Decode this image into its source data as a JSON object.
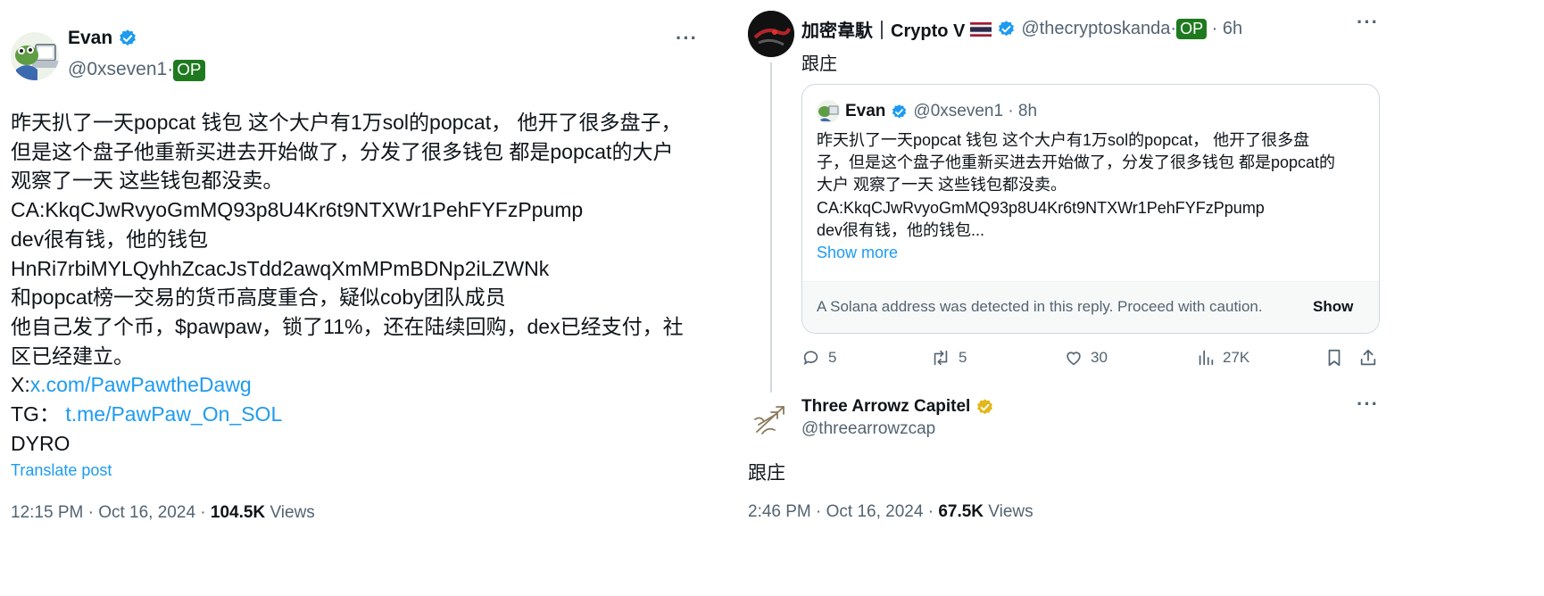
{
  "left_tweet": {
    "name": "Evan",
    "handle": "@0xseven1·",
    "op_label": "OP",
    "lines": [
      "昨天扒了一天popcat 钱包 这个大户有1万sol的popcat， 他开了很多盘子，",
      "但是这个盘子他重新买进去开始做了，分发了很多钱包 都是popcat的大户",
      "观察了一天 这些钱包都没卖。",
      "CA:KkqCJwRvyoGmMQ93p8U4Kr6t9NTXWr1PehFYFzPpump",
      "dev很有钱，他的钱包",
      "HnRi7rbiMYLQyhhZcacJsTdd2awqXmMPmBDNp2iLZWNk",
      "和popcat榜一交易的货币高度重合，疑似coby团队成员",
      "他自己发了个币，$pawpaw，锁了11%，还在陆续回购，dex已经支付，社",
      "区已经建立。"
    ],
    "x_prefix": "X:",
    "x_link": "x.com/PawPawtheDawg",
    "tg_prefix": "TG：",
    "tg_link": "t.me/PawPaw_On_SOL",
    "last_line": "DYRO",
    "translate": "Translate post",
    "time": "12:15 PM · Oct 16, 2024 · ",
    "views_count": "104.5K",
    "views_label": " Views"
  },
  "right_tweet": {
    "name": "加密韋馱｜Crypto V",
    "handle": "@thecryptoskanda·",
    "op_label": "OP",
    "age": " · 6h",
    "text": "跟庄",
    "quote": {
      "name": "Evan",
      "handle": "@0xseven1 · 8h",
      "lines": [
        "昨天扒了一天popcat 钱包 这个大户有1万sol的popcat， 他开了很多盘",
        "子，但是这个盘子他重新买进去开始做了，分发了很多钱包 都是popcat的",
        "大户 观察了一天 这些钱包都没卖。",
        "CA:KkqCJwRvyoGmMQ93p8U4Kr6t9NTXWr1PehFYFzPpump",
        "dev很有钱，他的钱包..."
      ],
      "show_more": "Show more"
    },
    "warning_text": "A Solana address was detected in this reply. Proceed with caution.",
    "warning_show": "Show",
    "actions": {
      "replies": "5",
      "reposts": "5",
      "likes": "30",
      "views": "27K"
    }
  },
  "reply_tweet": {
    "name": "Three Arrowz Capitel",
    "handle": "@threearrowzcap",
    "text": "跟庄",
    "time": "2:46 PM · Oct 16, 2024 · ",
    "views_count": "67.5K",
    "views_label": " Views"
  },
  "colors": {
    "link": "#1d9bf0",
    "verified_blue": "#1d9bf0",
    "verified_gold": "#e2b719",
    "op_green": "#1f7a1f",
    "muted": "#536471"
  }
}
